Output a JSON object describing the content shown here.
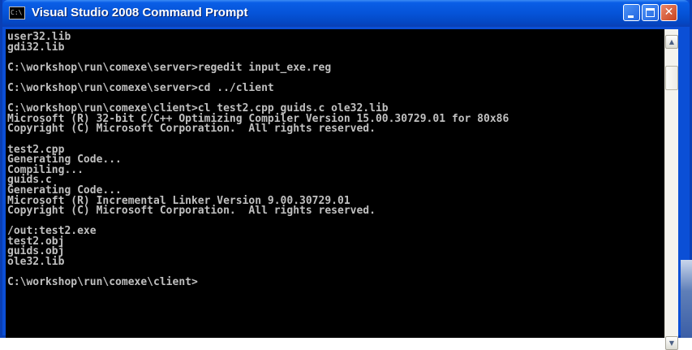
{
  "window": {
    "title": "Visual Studio 2008 Command Prompt",
    "icon": "command-prompt-icon",
    "icon_glyph": "C:\\"
  },
  "controls": {
    "minimize_icon": "minimize-icon",
    "maximize_icon": "maximize-icon",
    "close_icon": "close-icon",
    "close_glyph": "✕"
  },
  "console": {
    "lines": [
      "user32.lib",
      "gdi32.lib",
      "",
      "C:\\workshop\\run\\comexe\\server>regedit input_exe.reg",
      "",
      "C:\\workshop\\run\\comexe\\server>cd ../client",
      "",
      "C:\\workshop\\run\\comexe\\client>cl test2.cpp guids.c ole32.lib",
      "Microsoft (R) 32-bit C/C++ Optimizing Compiler Version 15.00.30729.01 for 80x86",
      "Copyright (C) Microsoft Corporation.  All rights reserved.",
      "",
      "test2.cpp",
      "Generating Code...",
      "Compiling...",
      "guids.c",
      "Generating Code...",
      "Microsoft (R) Incremental Linker Version 9.00.30729.01",
      "Copyright (C) Microsoft Corporation.  All rights reserved.",
      "",
      "/out:test2.exe",
      "test2.obj",
      "guids.obj",
      "ole32.lib",
      "",
      "C:\\workshop\\run\\comexe\\client>"
    ]
  },
  "scrollbar": {
    "up_glyph": "▲",
    "down_glyph": "▼"
  },
  "colors": {
    "titlebar": "#0553d8",
    "console_background": "#000000",
    "console_text": "#c0c0c0",
    "close_button": "#c9431e"
  }
}
